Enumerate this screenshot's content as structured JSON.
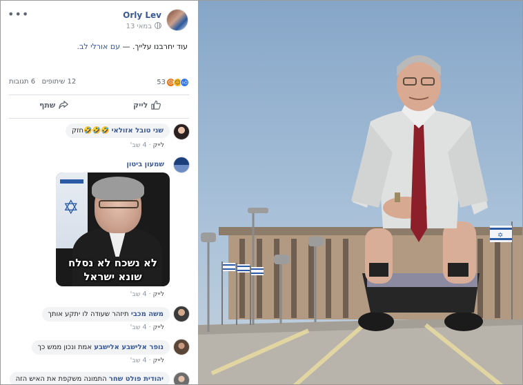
{
  "post": {
    "author": "Orly Lev",
    "date": "13 במאי",
    "text": "עוד יחרבנו עלייך. — ",
    "with_label": "עם אורלי לב.",
    "reaction_count": "53",
    "comments_count": "6 תגובות",
    "shares_count": "12 שיתופים",
    "like_label": "לייק",
    "share_label": "שתף",
    "more_label": "•••"
  },
  "comments": [
    {
      "name": "שני טובל אזולאי",
      "text": "🤣🤣🤣חזק",
      "like": "לייק",
      "time": "4 שב'"
    },
    {
      "name": "שמעון ביטון",
      "photo_caption_1": "לא נשכח לא נסלח",
      "photo_caption_2": "שונא ישראל",
      "like": "לייק",
      "time": "4 שב'"
    },
    {
      "name": "משה מכבי",
      "text": "תיזהר שעודה לו יתקע אותך",
      "like": "לייק",
      "time": "4 שב'"
    },
    {
      "name": "נופר אלישבע אלישבע",
      "text": "אמת ונכון ממש כך",
      "like": "לייק",
      "time": "4 שב'"
    },
    {
      "name": "יהודית פולט שחר",
      "text": "התמונה משקפת את האיש הזה"
    }
  ],
  "colors": {
    "link": "#385898",
    "muted": "#90949c",
    "bubble": "#f2f3f5",
    "like": "#3578e5"
  },
  "icons": {
    "like": "thumbs-up-icon",
    "share": "share-arrow-icon",
    "privacy": "globe-icon",
    "more": "more-dots-icon"
  }
}
